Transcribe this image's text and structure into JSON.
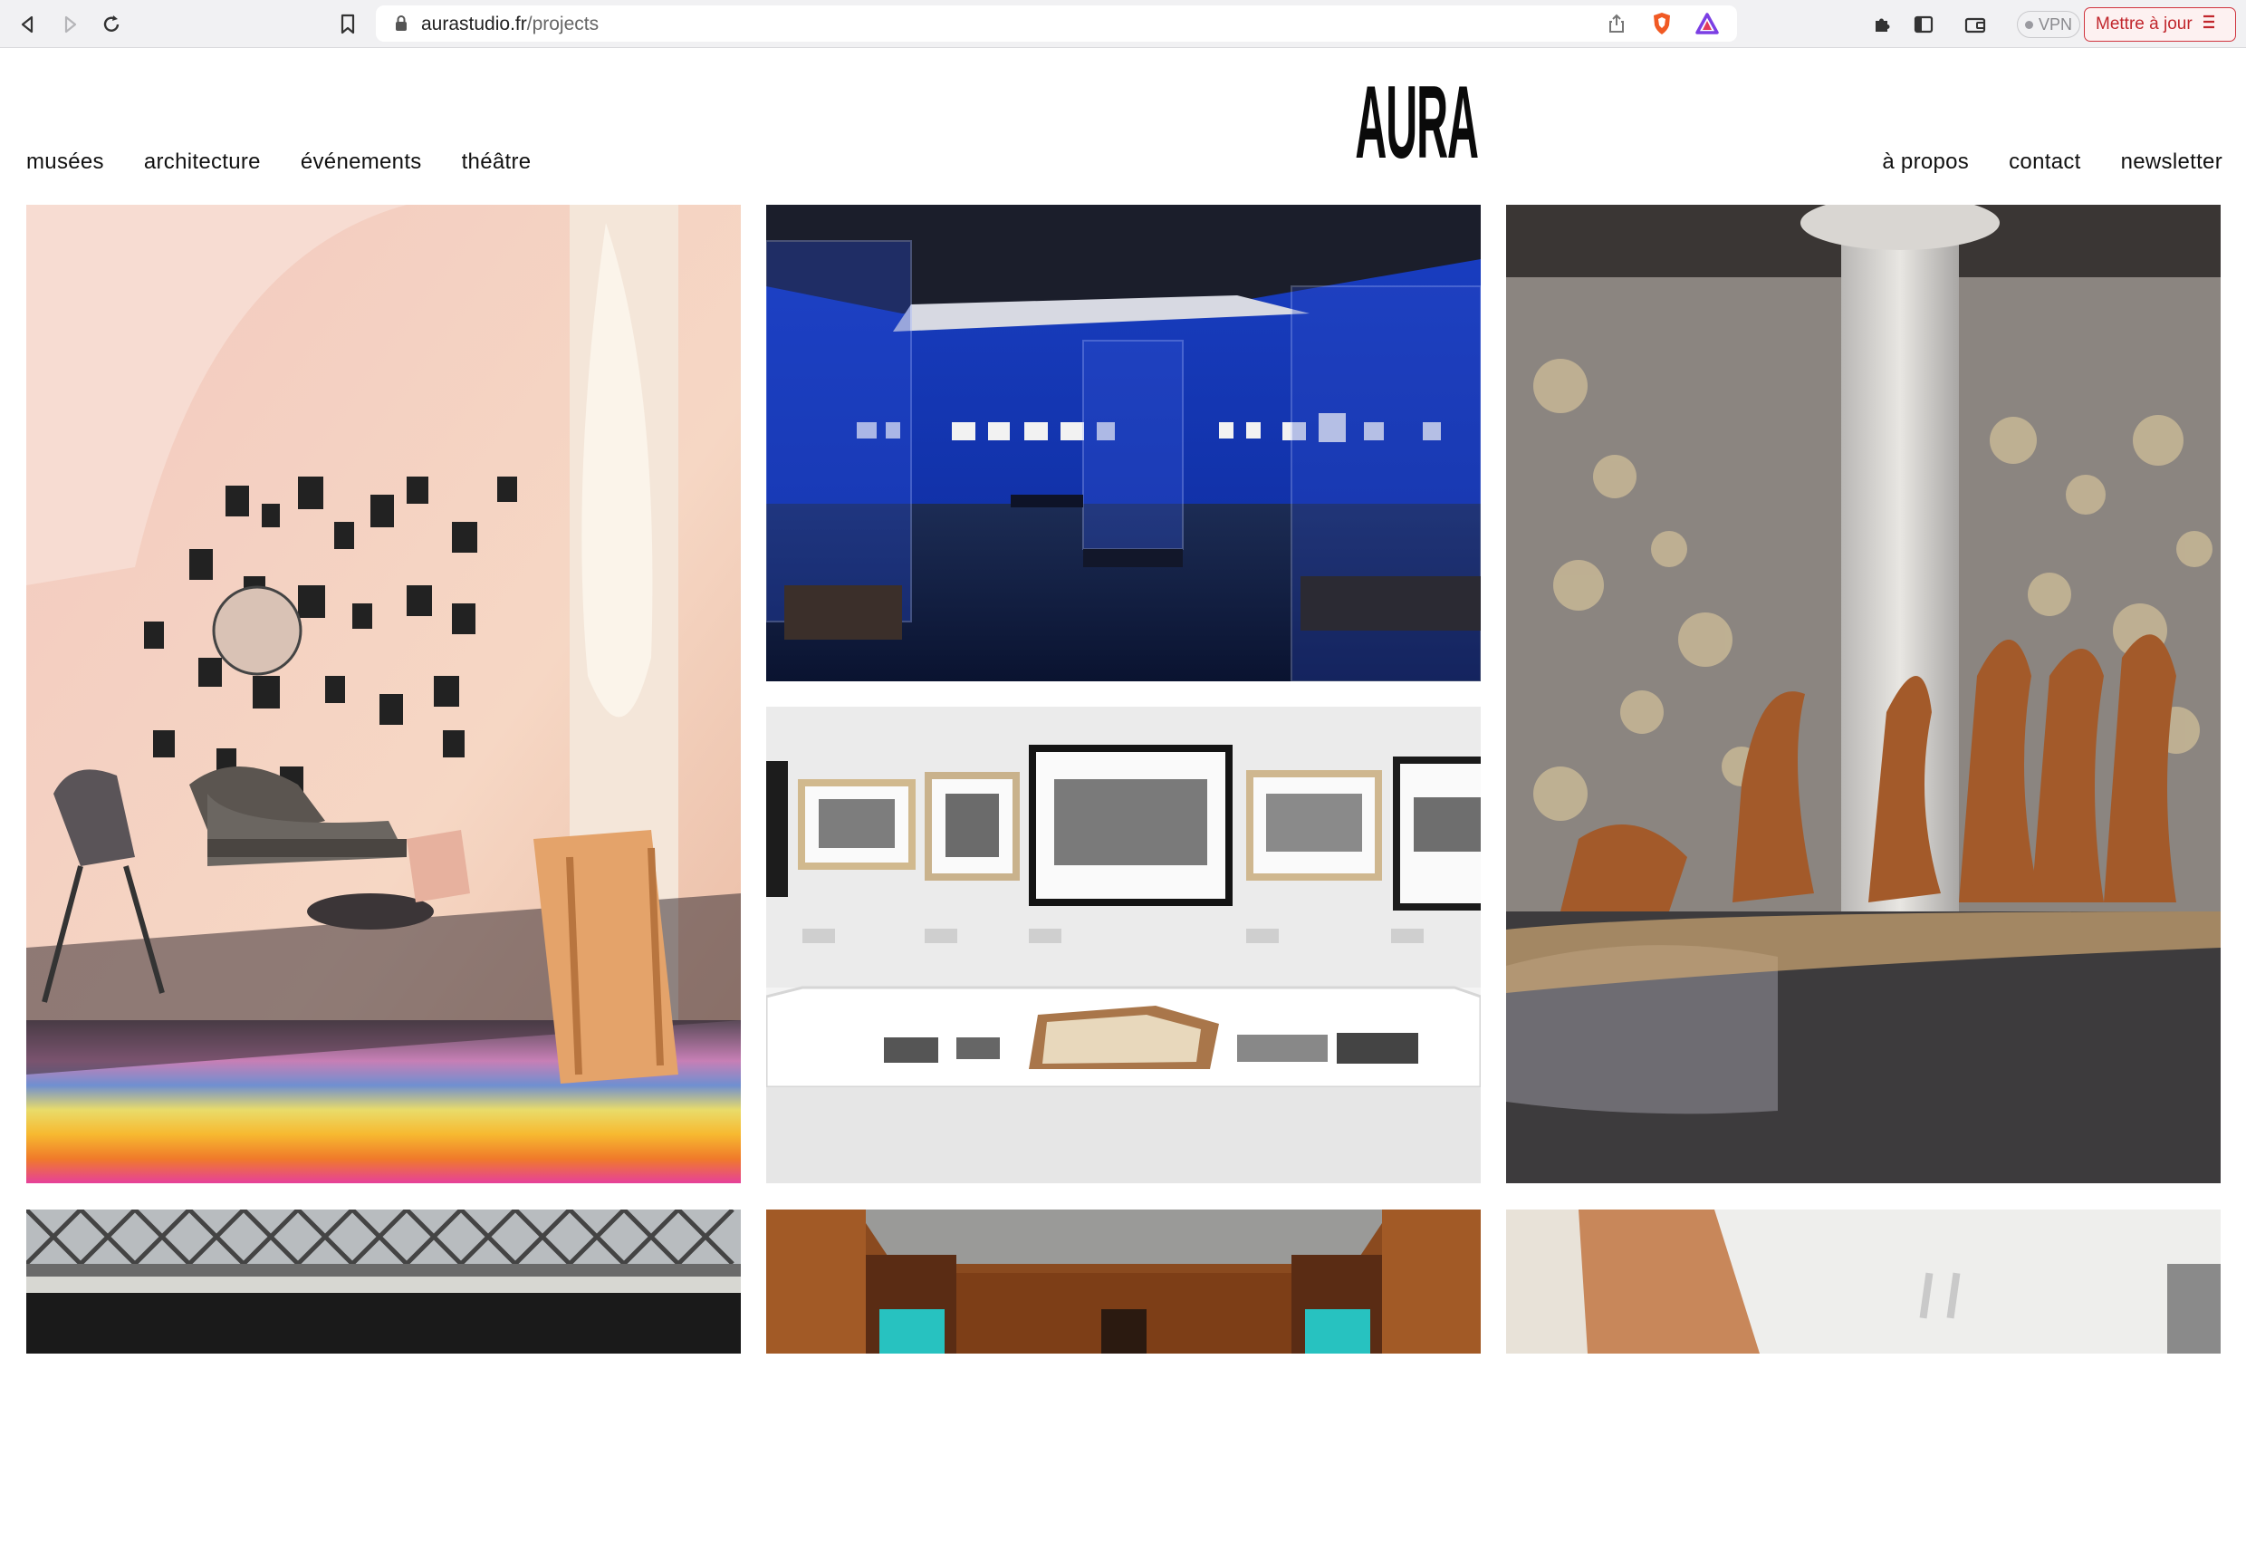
{
  "browser": {
    "url_host": "aurastudio.fr",
    "url_path": "/projects",
    "vpn_label": "VPN",
    "update_label": "Mettre à jour",
    "icons": [
      "back-icon",
      "forward-icon",
      "reload-icon",
      "bookmark-icon",
      "lock-icon",
      "share-icon",
      "brave-shield-icon",
      "brave-rewards-icon",
      "extensions-icon",
      "sidebar-icon",
      "wallet-icon",
      "menu-icon"
    ]
  },
  "site": {
    "logo": "AURA",
    "nav_left": [
      "musées",
      "architecture",
      "événements",
      "théâtre"
    ],
    "nav_right": [
      "à propos",
      "contact",
      "newsletter"
    ]
  },
  "projects": [
    {
      "id": "salon-rainbow",
      "alt": "exhibition room with chairs and rainbow light"
    },
    {
      "id": "blue-gallery",
      "alt": "blue museum gallery with vitrines"
    },
    {
      "id": "pillar-sculptures",
      "alt": "sculptures around a pillar with light projections"
    },
    {
      "id": "photo-frames",
      "alt": "framed photographs above a display case"
    },
    {
      "id": "facade",
      "alt": "building facade"
    },
    {
      "id": "wood-cabinets",
      "alt": "wooden cabinets with turquoise vitrines"
    },
    {
      "id": "white-corridor",
      "alt": "white corridor with ceiling lights"
    }
  ],
  "colors": {
    "accent_red": "#c1272d",
    "text": "#111111"
  }
}
